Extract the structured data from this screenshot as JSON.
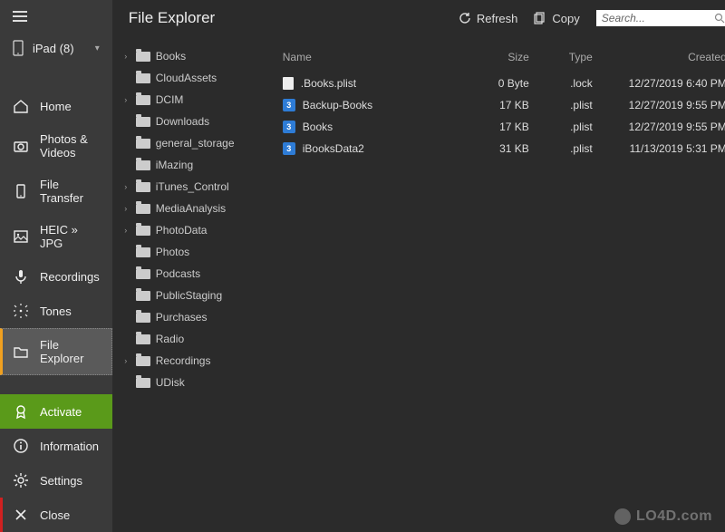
{
  "sidebar": {
    "device": {
      "label": "iPad (8)"
    },
    "nav": [
      {
        "label": "Home",
        "icon": "home"
      },
      {
        "label": "Photos & Videos",
        "icon": "camera"
      },
      {
        "label": "File Transfer",
        "icon": "phone"
      },
      {
        "label": "HEIC » JPG",
        "icon": "image"
      },
      {
        "label": "Recordings",
        "icon": "mic"
      },
      {
        "label": "Tones",
        "icon": "tones"
      },
      {
        "label": "File Explorer",
        "icon": "folder",
        "active": true
      }
    ],
    "bottom": [
      {
        "label": "Activate",
        "icon": "award",
        "class": "activate"
      },
      {
        "label": "Information",
        "icon": "info"
      },
      {
        "label": "Settings",
        "icon": "gear"
      },
      {
        "label": "Close",
        "icon": "close",
        "class": "close"
      }
    ]
  },
  "toolbar": {
    "title": "File Explorer",
    "refresh": "Refresh",
    "copy": "Copy",
    "search_placeholder": "Search..."
  },
  "tree": [
    {
      "label": "Books",
      "expandable": true
    },
    {
      "label": "CloudAssets"
    },
    {
      "label": "DCIM",
      "expandable": true
    },
    {
      "label": "Downloads"
    },
    {
      "label": "general_storage"
    },
    {
      "label": "iMazing"
    },
    {
      "label": "iTunes_Control",
      "expandable": true
    },
    {
      "label": "MediaAnalysis",
      "expandable": true
    },
    {
      "label": "PhotoData",
      "expandable": true
    },
    {
      "label": "Photos"
    },
    {
      "label": "Podcasts"
    },
    {
      "label": "PublicStaging"
    },
    {
      "label": "Purchases"
    },
    {
      "label": "Radio"
    },
    {
      "label": "Recordings",
      "expandable": true
    },
    {
      "label": "UDisk"
    }
  ],
  "files": {
    "columns": {
      "name": "Name",
      "size": "Size",
      "type": "Type",
      "created": "Created"
    },
    "rows": [
      {
        "name": ".Books.plist",
        "size": "0 Byte",
        "type": ".lock",
        "created": "12/27/2019 6:40 PM",
        "icon": "doc"
      },
      {
        "name": "Backup-Books",
        "size": "17 KB",
        "type": ".plist",
        "created": "12/27/2019 9:55 PM",
        "icon": "blue"
      },
      {
        "name": "Books",
        "size": "17 KB",
        "type": ".plist",
        "created": "12/27/2019 9:55 PM",
        "icon": "blue"
      },
      {
        "name": "iBooksData2",
        "size": "31 KB",
        "type": ".plist",
        "created": "11/13/2019 5:31 PM",
        "icon": "blue"
      }
    ]
  },
  "watermark": "LO4D.com"
}
